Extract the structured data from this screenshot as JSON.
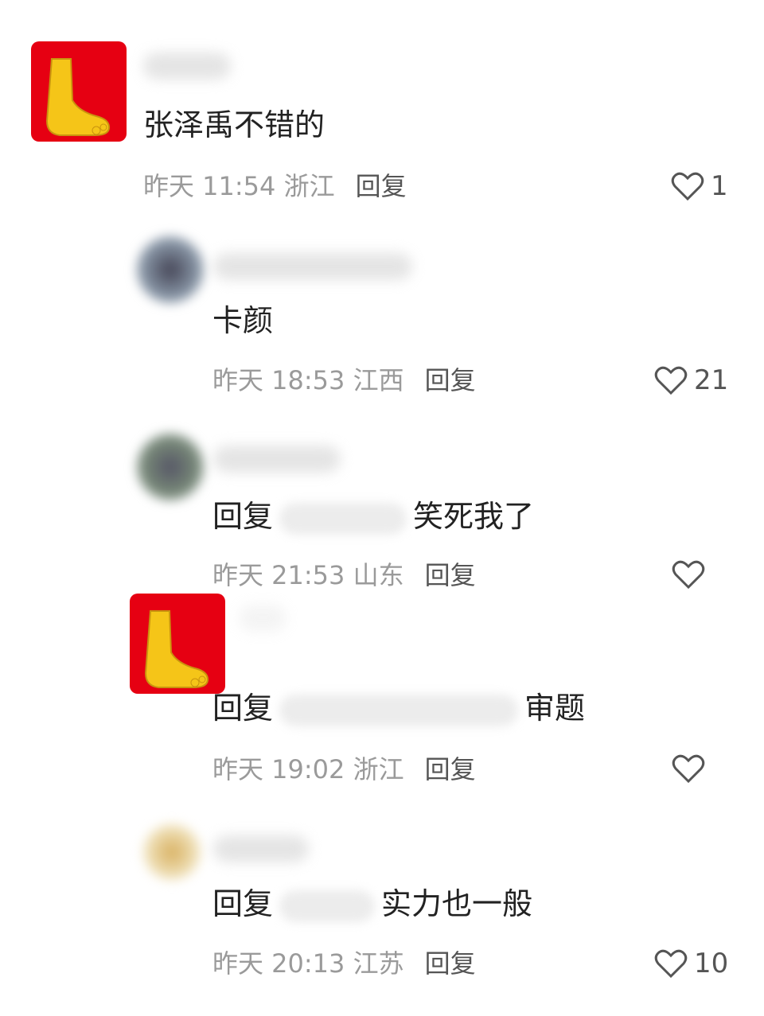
{
  "comments": [
    {
      "text": "张泽禹不错的",
      "date": "昨天 11:54 浙江",
      "reply_label": "回复",
      "likes": "1"
    },
    {
      "text": "卡颜",
      "date": "昨天 18:53 江西",
      "reply_label": "回复",
      "likes": "21"
    },
    {
      "reply_prefix": "回复",
      "text": "笑死我了",
      "date": "昨天 21:53 山东",
      "reply_label": "回复",
      "likes": ""
    },
    {
      "reply_prefix": "回复",
      "text": "审题",
      "date": "昨天 19:02 浙江",
      "reply_label": "回复",
      "likes": ""
    },
    {
      "reply_prefix": "回复",
      "text": "实力也一般",
      "date": "昨天 20:13 江苏",
      "reply_label": "回复",
      "likes": "10"
    }
  ],
  "colors": {
    "avatar_bg": "#e60012",
    "foot": "#f5c518"
  },
  "icons": {
    "avatar": "foot-icon",
    "like": "heart-outline-icon"
  }
}
